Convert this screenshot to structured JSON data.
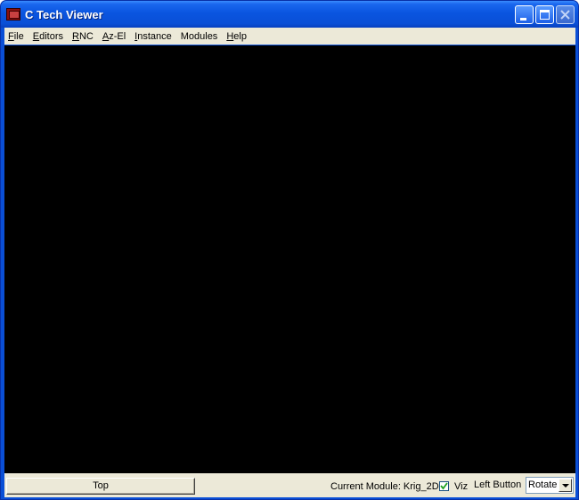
{
  "window": {
    "title": "C Tech Viewer",
    "accent_color": "#0a4fd6",
    "icons": {
      "app": "app-icon",
      "minimize": "minimize-icon",
      "maximize": "maximize-icon",
      "close": "close-icon"
    }
  },
  "menu": {
    "items": [
      {
        "accel": "F",
        "rest": "ile"
      },
      {
        "accel": "E",
        "rest": "ditors"
      },
      {
        "accel": "R",
        "rest": "NC"
      },
      {
        "accel": "A",
        "rest": "z-El"
      },
      {
        "accel": "I",
        "rest": "nstance"
      },
      {
        "accel": "",
        "rest": "Modules"
      },
      {
        "accel": "H",
        "rest": "elp"
      }
    ]
  },
  "viewport": {
    "background": "#000000"
  },
  "status": {
    "view_button": "Top",
    "current_module_label": "Current Module: Krig_2D",
    "viz_checked": true,
    "viz_label": "Viz",
    "left_button_label": "Left Button",
    "left_button_value": "Rotate"
  }
}
